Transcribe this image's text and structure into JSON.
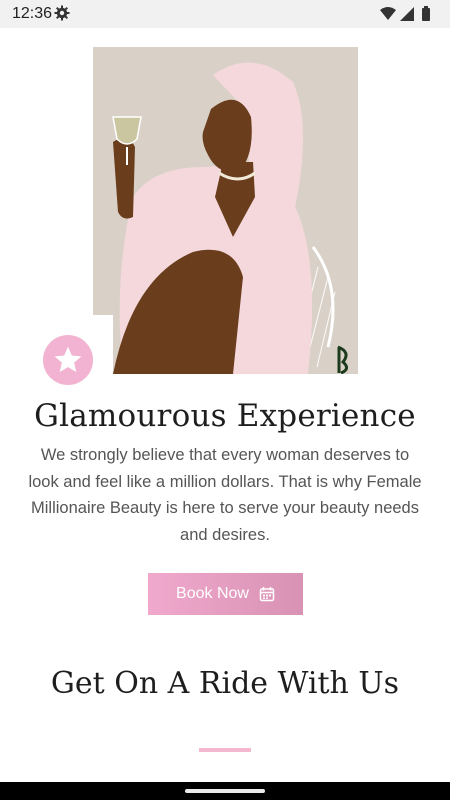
{
  "status_bar": {
    "time": "12:36",
    "icons": [
      "gear-icon",
      "wifi-icon",
      "signal-icon",
      "battery-icon"
    ]
  },
  "hero": {
    "icons": [
      "hero-illustration",
      "star-icon"
    ],
    "colors": {
      "background": "#d9d1c7",
      "robe": "#f4d8dc",
      "skin": "#6a3d1c",
      "badge": "#f1b3d1"
    }
  },
  "main": {
    "title": "Glamourous Experience",
    "description": "We strongly believe that every woman deserves to look and feel like a million dollars. That is why Female Millionaire Beauty is here to serve your beauty needs and desires.",
    "book_button": {
      "label": "Book Now",
      "icon": "calendar-icon",
      "color": "#e39bbf"
    },
    "section_title": "Get On A Ride With Us",
    "divider_color": "#f4b7d0"
  }
}
